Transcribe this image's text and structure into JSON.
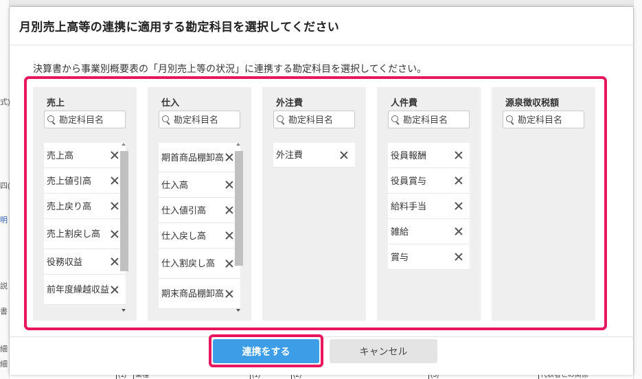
{
  "background": {
    "left_fragments": [
      "式)",
      "四(",
      "明",
      "説",
      "書",
      "細",
      "細"
    ],
    "bottom_fragments": [
      "(1)",
      "業種",
      "(1)",
      "(2)",
      "(3)",
      "代表者との関係"
    ]
  },
  "modal": {
    "title": "月別売上高等の連携に適用する勘定科目を選択してください",
    "instruction": "決算書から事業別概要表の「月別売上等の状況」に連携する勘定科目を選択してください。",
    "search_placeholder": "勘定科目名",
    "columns": [
      {
        "title": "売上",
        "items": [
          "売上高",
          "売上値引高",
          "売上戻り高",
          "売上割戻し高",
          "役務収益",
          "前年度繰越収益"
        ],
        "has_scrollbar": true
      },
      {
        "title": "仕入",
        "items": [
          "期首商品棚卸高",
          "仕入高",
          "仕入値引高",
          "仕入戻し高",
          "仕入割戻し高",
          "期末商品棚卸高"
        ],
        "has_scrollbar": true
      },
      {
        "title": "外注費",
        "items": [
          "外注費"
        ],
        "has_scrollbar": false
      },
      {
        "title": "人件費",
        "items": [
          "役員報酬",
          "役員賞与",
          "給料手当",
          "雑給",
          "賞与"
        ],
        "has_scrollbar": false
      },
      {
        "title": "源泉徴収税額",
        "items": [],
        "has_scrollbar": false
      }
    ],
    "buttons": {
      "primary": "連携をする",
      "secondary": "キャンセル"
    }
  },
  "colors": {
    "highlight": "#e8175d",
    "primary_button": "#3d9de6",
    "column_bg": "#efefef"
  }
}
